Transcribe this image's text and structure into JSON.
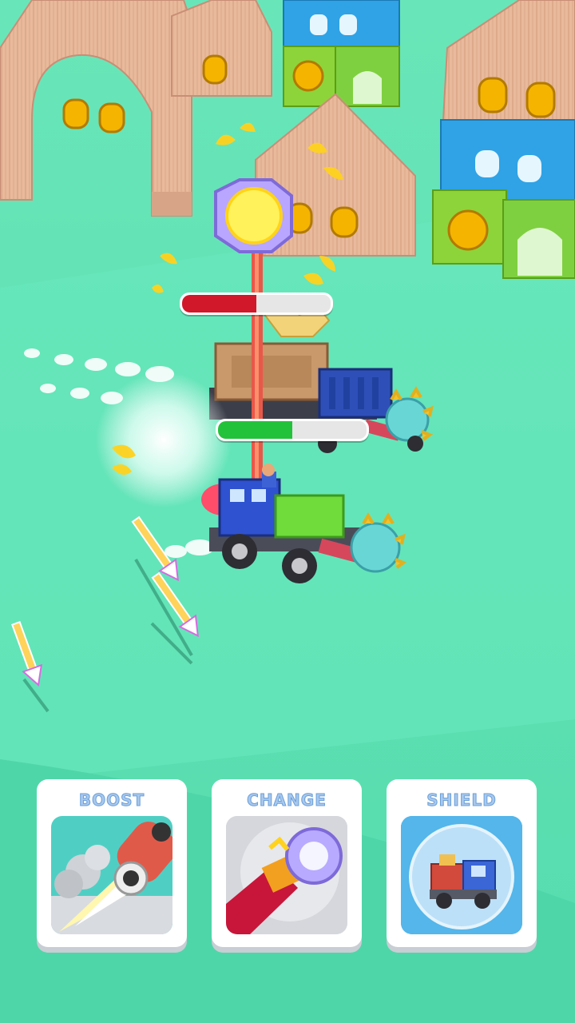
{
  "game": {
    "enemy_health": 0.5,
    "player_health": 0.5,
    "colors": {
      "ground": "#5fe3b4",
      "enemy_bar": "#d0182a",
      "player_bar": "#22c23a",
      "card_label": "#a8c8ee"
    }
  },
  "abilities": [
    {
      "label": "BOOST",
      "icon": "rocket-boost-icon"
    },
    {
      "label": "CHANGE",
      "icon": "weapon-hammer-icon"
    },
    {
      "label": "SHIELD",
      "icon": "bubble-shield-car-icon"
    }
  ]
}
